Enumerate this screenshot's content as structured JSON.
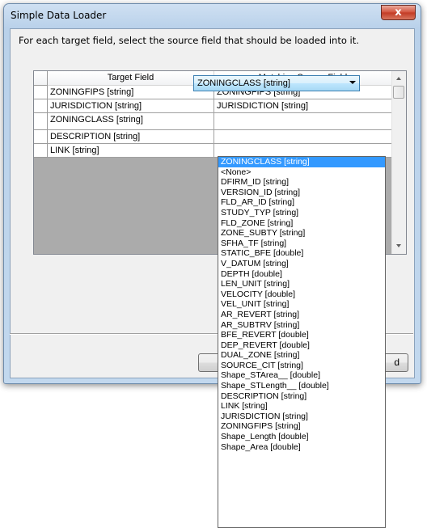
{
  "window": {
    "title": "Simple Data Loader",
    "close_label": "x"
  },
  "instruction": "For each target field, select the source field that should be loaded into it.",
  "grid": {
    "headers": [
      "Target Field",
      "Matching Source Field"
    ],
    "rows": [
      {
        "target": "ZONINGFIPS [string]",
        "source": "ZONINGFIPS [string]"
      },
      {
        "target": "JURISDICTION [string]",
        "source": "JURISDICTION [string]"
      },
      {
        "target": "ZONINGCLASS [string]",
        "source": "ZONINGCLASS [string]"
      },
      {
        "target": "DESCRIPTION [string]",
        "source": ""
      },
      {
        "target": "LINK [string]",
        "source": ""
      }
    ]
  },
  "dropdown": {
    "selected": "ZONINGCLASS [string]",
    "options": [
      "ZONINGCLASS [string]",
      "<None>",
      "DFIRM_ID [string]",
      "VERSION_ID [string]",
      "FLD_AR_ID [string]",
      "STUDY_TYP [string]",
      "FLD_ZONE [string]",
      "ZONE_SUBTY [string]",
      "SFHA_TF [string]",
      "STATIC_BFE [double]",
      "V_DATUM [string]",
      "DEPTH [double]",
      "LEN_UNIT [string]",
      "VELOCITY [double]",
      "VEL_UNIT [string]",
      "AR_REVERT [string]",
      "AR_SUBTRV [string]",
      "BFE_REVERT [double]",
      "DEP_REVERT [double]",
      "DUAL_ZONE [string]",
      "SOURCE_CIT [string]",
      "Shape_STArea__ [double]",
      "Shape_STLength__ [double]",
      "DESCRIPTION [string]",
      "LINK [string]",
      "JURISDICTION [string]",
      "ZONINGFIPS [string]",
      "Shape_Length [double]",
      "Shape_Area [double]"
    ]
  },
  "buttons": {
    "left_label": "",
    "right_label": "d"
  }
}
